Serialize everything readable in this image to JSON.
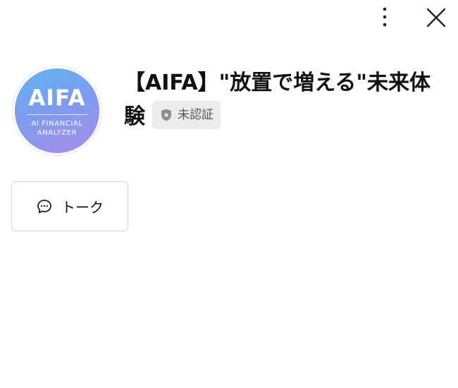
{
  "header": {
    "more_icon": "vertical-dots-icon",
    "close_icon": "close-x-icon"
  },
  "profile": {
    "avatar": {
      "title": "AIFA",
      "subtitle": "AI FINANCIAL\nANALYZER",
      "gradient_colors": [
        "#5fb6f2",
        "#a98ce8"
      ]
    },
    "name": "【AIFA】\"放置で増える\"未来体験",
    "badge": {
      "label": "未認証",
      "icon": "shield-star-icon"
    }
  },
  "actions": {
    "talk": {
      "label": "トーク",
      "icon": "speech-bubble-icon"
    }
  }
}
